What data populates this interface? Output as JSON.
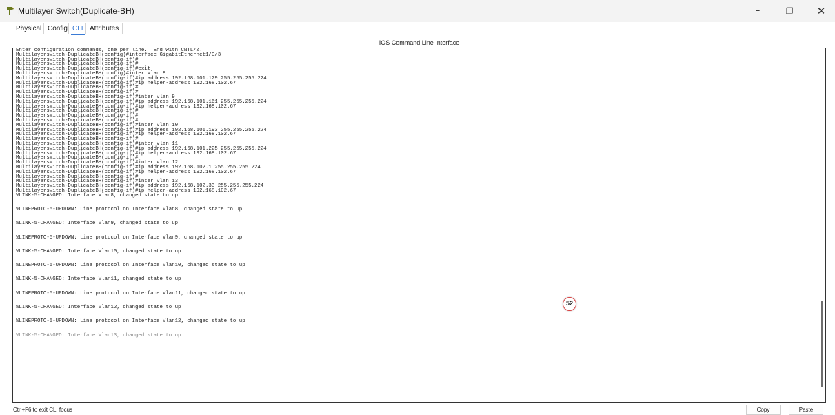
{
  "window": {
    "title": "Multilayer Switch(Duplicate-BH)",
    "min_glyph": "–",
    "max_glyph": "❐",
    "close_glyph": "✕"
  },
  "tabs": [
    {
      "label": "Physical"
    },
    {
      "label": "Config"
    },
    {
      "label": "CLI",
      "active": true
    },
    {
      "label": "Attributes"
    }
  ],
  "cli": {
    "header": "IOS Command Line Interface",
    "lines": [
      "Enter configuration commands, one per line.  End with CNTL/Z.",
      "Multilayerswitch-DuplicateBH(config)#interface GigabitEthernet1/0/3",
      "Multilayerswitch-DuplicateBH(config-if)#",
      "Multilayerswitch-DuplicateBH(config-if)#",
      "Multilayerswitch-DuplicateBH(config-if)#exit",
      "Multilayerswitch-DuplicateBH(config)#inter vlan 8",
      "Multilayerswitch-DuplicateBH(config-if)#ip address 192.168.101.129 255.255.255.224",
      "Multilayerswitch-DuplicateBH(config-if)#ip helper-address 192.168.102.67",
      "Multilayerswitch-DuplicateBH(config-if)#",
      "Multilayerswitch-DuplicateBH(config-if)#",
      "Multilayerswitch-DuplicateBH(config-if)#inter vlan 9",
      "Multilayerswitch-DuplicateBH(config-if)#ip address 192.168.101.161 255.255.255.224",
      "Multilayerswitch-DuplicateBH(config-if)#ip helper-address 192.168.102.67",
      "Multilayerswitch-DuplicateBH(config-if)#",
      "Multilayerswitch-DuplicateBH(config-if)#",
      "Multilayerswitch-DuplicateBH(config-if)#",
      "Multilayerswitch-DuplicateBH(config-if)#inter vlan 10",
      "Multilayerswitch-DuplicateBH(config-if)#ip address 192.168.101.193 255.255.255.224",
      "Multilayerswitch-DuplicateBH(config-if)#ip helper-address 192.168.102.67",
      "Multilayerswitch-DuplicateBH(config-if)#",
      "Multilayerswitch-DuplicateBH(config-if)#inter vlan 11",
      "Multilayerswitch-DuplicateBH(config-if)#ip address 192.168.101.225 255.255.255.224",
      "Multilayerswitch-DuplicateBH(config-if)#ip helper-address 192.168.102.67",
      "Multilayerswitch-DuplicateBH(config-if)#",
      "Multilayerswitch-DuplicateBH(config-if)#inter vlan 12",
      "Multilayerswitch-DuplicateBH(config-if)#ip address 192.168.102.1 255.255.255.224",
      "Multilayerswitch-DuplicateBH(config-if)#ip helper-address 192.168.102.67",
      "Multilayerswitch-DuplicateBH(config-if)#",
      "Multilayerswitch-DuplicateBH(config-if)#inter vlan 13",
      "Multilayerswitch-DuplicateBH(config-if)#ip address 192.168.102.33 255.255.255.224",
      "Multilayerswitch-DuplicateBH(config-if)#ip helper-address 192.168.102.67"
    ],
    "log_lines": [
      "%LINK-5-CHANGED: Interface Vlan8, changed state to up",
      "%LINEPROTO-5-UPDOWN: Line protocol on Interface Vlan8, changed state to up",
      "%LINK-5-CHANGED: Interface Vlan9, changed state to up",
      "%LINEPROTO-5-UPDOWN: Line protocol on Interface Vlan9, changed state to up",
      "%LINK-5-CHANGED: Interface Vlan10, changed state to up",
      "%LINEPROTO-5-UPDOWN: Line protocol on Interface Vlan10, changed state to up",
      "%LINK-5-CHANGED: Interface Vlan11, changed state to up",
      "%LINEPROTO-5-UPDOWN: Line protocol on Interface Vlan11, changed state to up",
      "%LINK-5-CHANGED: Interface Vlan12, changed state to up",
      "%LINEPROTO-5-UPDOWN: Line protocol on Interface Vlan12, changed state to up"
    ],
    "partial_line": "%LINK-5-CHANGED: Interface Vlan13, changed state to up"
  },
  "badge": {
    "value": "52",
    "color": "#d94040"
  },
  "footer": {
    "status": "Ctrl+F6 to exit CLI focus",
    "copy_label": "Copy",
    "paste_label": "Paste"
  },
  "colors": {
    "accent": "#3a7bd5"
  }
}
